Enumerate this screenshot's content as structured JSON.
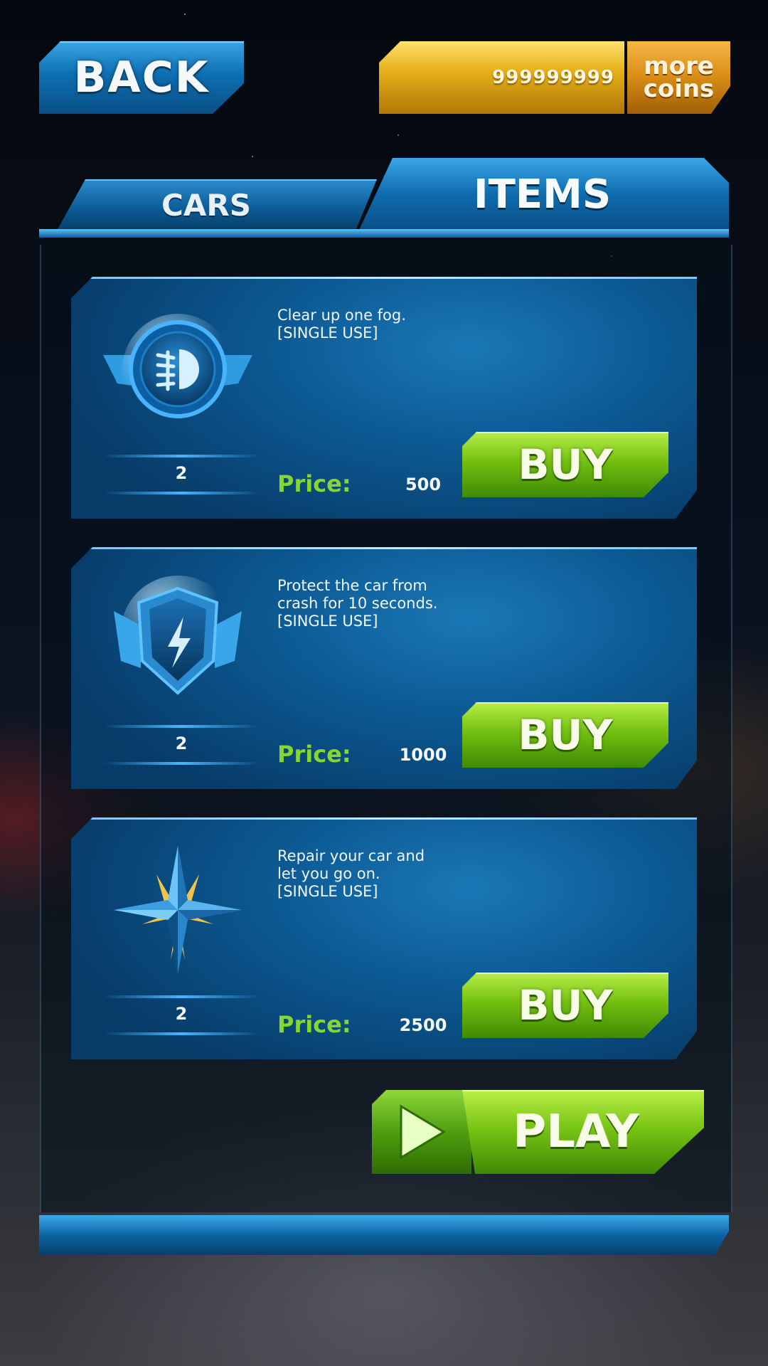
{
  "header": {
    "back_label": "BACK",
    "coins": "999999999",
    "more_coins_line1": "more",
    "more_coins_line2": "coins"
  },
  "tabs": [
    {
      "label": "CARS",
      "active": false
    },
    {
      "label": "ITEMS",
      "active": true
    }
  ],
  "items": [
    {
      "icon": "fog-light-icon",
      "description": "Clear up one fog.\n[SINGLE USE]",
      "quantity": "2",
      "price_label": "Price:",
      "price": "500",
      "buy_label": "BUY"
    },
    {
      "icon": "shield-lightning-icon",
      "description": "Protect the car from\ncrash for 10 seconds.\n[SINGLE USE]",
      "quantity": "2",
      "price_label": "Price:",
      "price": "1000",
      "buy_label": "BUY"
    },
    {
      "icon": "star-repair-icon",
      "description": "Repair your car and\nlet you go on.\n[SINGLE USE]",
      "quantity": "2",
      "price_label": "Price:",
      "price": "2500",
      "buy_label": "BUY"
    }
  ],
  "play_label": "PLAY",
  "colors": {
    "accent_blue": "#0d6fb2",
    "buy_green": "#74c010",
    "price_green": "#86d633",
    "coin_gold": "#e6b11a"
  }
}
